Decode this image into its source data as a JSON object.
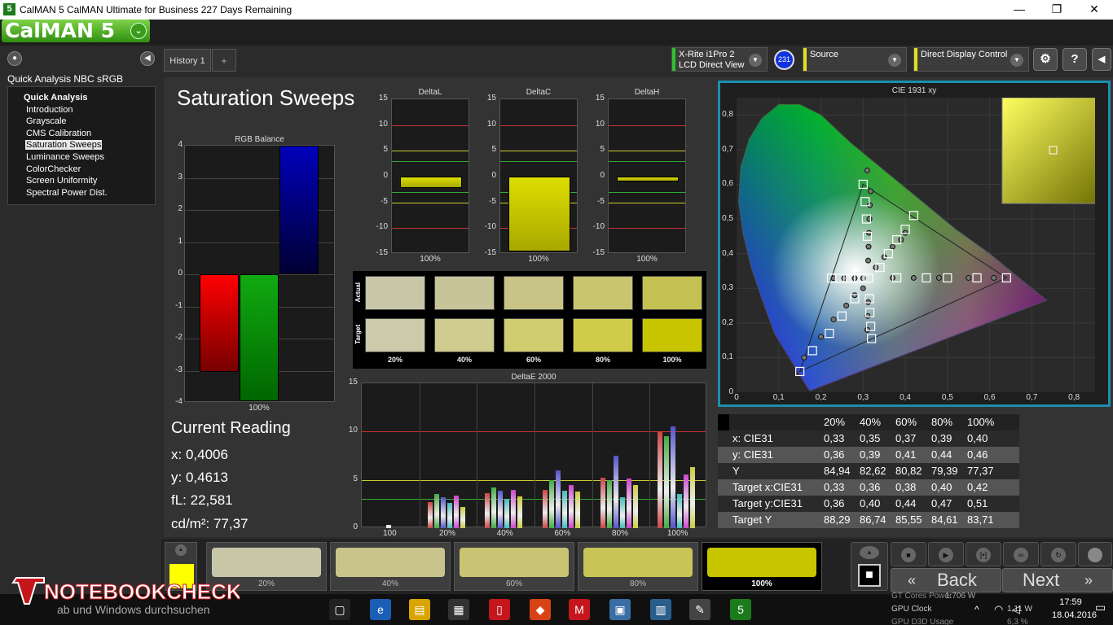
{
  "window": {
    "title": "CalMAN 5 CalMAN Ultimate for Business 227 Days Remaining",
    "app_icon": "5",
    "minimize": "—",
    "maximize": "❐",
    "close": "✕"
  },
  "logo": {
    "text": "CalMAN 5",
    "chevron": "⌄"
  },
  "sidebar": {
    "title": "Quick Analysis NBC sRGB",
    "head": "Quick Analysis",
    "items": [
      {
        "label": "Introduction"
      },
      {
        "label": "Grayscale"
      },
      {
        "label": "CMS Calibration"
      },
      {
        "label": "Saturation Sweeps"
      },
      {
        "label": "Luminance Sweeps"
      },
      {
        "label": "ColorChecker"
      },
      {
        "label": "Screen Uniformity"
      },
      {
        "label": "Spectral Power Dist."
      }
    ],
    "collapse_icon": "◀",
    "dot": "●"
  },
  "tabs": [
    {
      "label": "History 1"
    }
  ],
  "tab_add": "+",
  "toolbar": {
    "meter_line1": "X-Rite i1Pro 2",
    "meter_line2": "LCD Direct View",
    "meter_badge": "231",
    "source_label": "Source",
    "display_label": "Direct Display Control",
    "settings_icon": "⚙",
    "help_icon": "?",
    "side_icon": "◀",
    "arrow": "▼"
  },
  "page_title": "Saturation Sweeps",
  "rgb_balance": {
    "title": "RGB Balance",
    "yticks": [
      "4",
      "3",
      "2",
      "1",
      "0",
      "-1",
      "-2",
      "-3",
      "-4"
    ],
    "xlabel": "100%",
    "values": {
      "red": -3.05,
      "green": -3.95,
      "blue": 4.0
    }
  },
  "delta_charts": [
    {
      "title": "DeltaL",
      "value": -2.2,
      "xlabel": "100%"
    },
    {
      "title": "DeltaC",
      "value": -14.6,
      "xlabel": "100%"
    },
    {
      "title": "DeltaH",
      "value": -0.9,
      "xlabel": "100%"
    }
  ],
  "delta_yticks": [
    "15",
    "10",
    "5",
    "0",
    "-5",
    "-10",
    "-15"
  ],
  "swatches": {
    "actual_label": "Actual",
    "target_label": "Target",
    "labels": [
      "20%",
      "40%",
      "60%",
      "80%",
      "100%"
    ],
    "actual_colors": [
      "#c8c6a8",
      "#c8c49a",
      "#c8c488",
      "#c8c470",
      "#c4c052"
    ],
    "target_colors": [
      "#cccaaa",
      "#d0cc90",
      "#d0cc70",
      "#d0cc4a",
      "#c8c400"
    ]
  },
  "deltae": {
    "title": "DeltaE 2000",
    "yticks": [
      "15",
      "10",
      "5",
      "0"
    ],
    "categories": [
      "100",
      "20%",
      "40%",
      "60%",
      "80%",
      "100%"
    ],
    "groups": [
      [
        0.3
      ],
      [
        2.7,
        3.5,
        3.2,
        2.6,
        3.4,
        2.2
      ],
      [
        3.6,
        4.2,
        3.9,
        3.0,
        4.0,
        3.3
      ],
      [
        4.0,
        5.0,
        6.0,
        3.9,
        4.5,
        3.8
      ],
      [
        5.2,
        5.0,
        7.5,
        3.2,
        5.1,
        4.5
      ],
      [
        10.0,
        9.5,
        10.5,
        3.5,
        5.6,
        6.3
      ]
    ],
    "bar_colors": [
      "#c44",
      "#4a4",
      "#55c",
      "#4bb",
      "#c4c",
      "#cc4"
    ],
    "ref_lines": [
      10,
      5,
      3
    ]
  },
  "current_reading": {
    "title": "Current Reading",
    "x": "x: 0,4006",
    "y": "y: 0,4613",
    "fl": "fL: 22,581",
    "cdm2": "cd/m²: 77,37"
  },
  "cie": {
    "title": "CIE 1931 xy",
    "xticks": [
      "0",
      "0,1",
      "0,2",
      "0,3",
      "0,4",
      "0,5",
      "0,6",
      "0,7",
      "0,8"
    ],
    "yticks": [
      "0,8",
      "0,7",
      "0,6",
      "0,5",
      "0,4",
      "0,3",
      "0,2",
      "0,1",
      "0"
    ],
    "targets": [
      [
        0.64,
        0.33
      ],
      [
        0.57,
        0.33
      ],
      [
        0.5,
        0.33
      ],
      [
        0.45,
        0.33
      ],
      [
        0.38,
        0.33
      ],
      [
        0.3127,
        0.329
      ],
      [
        0.3,
        0.6
      ],
      [
        0.305,
        0.55
      ],
      [
        0.308,
        0.5
      ],
      [
        0.31,
        0.45
      ],
      [
        0.42,
        0.51
      ],
      [
        0.4,
        0.47
      ],
      [
        0.38,
        0.44
      ],
      [
        0.36,
        0.4
      ],
      [
        0.34,
        0.36
      ],
      [
        0.15,
        0.06
      ],
      [
        0.18,
        0.12
      ],
      [
        0.22,
        0.17
      ],
      [
        0.25,
        0.22
      ],
      [
        0.28,
        0.27
      ],
      [
        0.32,
        0.155
      ],
      [
        0.318,
        0.19
      ],
      [
        0.316,
        0.23
      ],
      [
        0.315,
        0.27
      ],
      [
        0.225,
        0.329
      ],
      [
        0.245,
        0.329
      ],
      [
        0.27,
        0.329
      ],
      [
        0.29,
        0.329
      ]
    ],
    "measured": [
      [
        0.61,
        0.33
      ],
      [
        0.55,
        0.33
      ],
      [
        0.48,
        0.33
      ],
      [
        0.42,
        0.33
      ],
      [
        0.37,
        0.33
      ],
      [
        0.31,
        0.64
      ],
      [
        0.318,
        0.58
      ],
      [
        0.316,
        0.54
      ],
      [
        0.315,
        0.5
      ],
      [
        0.314,
        0.46
      ],
      [
        0.313,
        0.42
      ],
      [
        0.312,
        0.38
      ],
      [
        0.4,
        0.46
      ],
      [
        0.39,
        0.44
      ],
      [
        0.37,
        0.42
      ],
      [
        0.35,
        0.39
      ],
      [
        0.33,
        0.36
      ],
      [
        0.16,
        0.1
      ],
      [
        0.2,
        0.16
      ],
      [
        0.23,
        0.21
      ],
      [
        0.26,
        0.25
      ],
      [
        0.28,
        0.28
      ],
      [
        0.31,
        0.18
      ],
      [
        0.311,
        0.22
      ],
      [
        0.312,
        0.26
      ],
      [
        0.3,
        0.3
      ],
      [
        0.23,
        0.329
      ],
      [
        0.255,
        0.329
      ],
      [
        0.28,
        0.329
      ],
      [
        0.3,
        0.329
      ]
    ]
  },
  "table": {
    "headers": [
      "20%",
      "40%",
      "60%",
      "80%",
      "100%"
    ],
    "rows": [
      {
        "label": "x: CIE31",
        "values": [
          "0,33",
          "0,35",
          "0,37",
          "0,39",
          "0,40"
        ]
      },
      {
        "label": "y: CIE31",
        "values": [
          "0,36",
          "0,39",
          "0,41",
          "0,44",
          "0,46"
        ]
      },
      {
        "label": "Y",
        "values": [
          "84,94",
          "82,62",
          "80,82",
          "79,39",
          "77,37"
        ]
      },
      {
        "label": "Target x:CIE31",
        "values": [
          "0,33",
          "0,36",
          "0,38",
          "0,40",
          "0,42"
        ]
      },
      {
        "label": "Target y:CIE31",
        "values": [
          "0,36",
          "0,40",
          "0,44",
          "0,47",
          "0,51"
        ]
      },
      {
        "label": "Target Y",
        "values": [
          "88,29",
          "86,74",
          "85,55",
          "84,61",
          "83,71"
        ]
      }
    ]
  },
  "bottom_swatches": [
    {
      "label": "20%",
      "color": "#c8c6a8"
    },
    {
      "label": "40%",
      "color": "#c8c48c"
    },
    {
      "label": "60%",
      "color": "#c8c474"
    },
    {
      "label": "80%",
      "color": "#c8c456"
    },
    {
      "label": "100%",
      "color": "#c8c400"
    }
  ],
  "controls": {
    "stop": "■",
    "play": "▶",
    "loop": "[•]",
    "infinity": "∞",
    "refresh": "↻",
    "back": "Back",
    "next": "Next",
    "back_arrows": "«",
    "next_arrows": "»",
    "up": "▲"
  },
  "watermark": {
    "brand": "NOTEBOOKCHECK",
    "overlay": "ab und Windows durchsuchen"
  },
  "taskbar": {
    "time": "17:59",
    "date": "18.04.2016",
    "tray_line1": "GT Cores Power",
    "tray_line2": "GPU Clock",
    "tray_line3": "GPU D3D Usage",
    "tray_val": "1.706 W",
    "tray_val2": "1,11 W",
    "tray_val3": "6,3 %"
  }
}
